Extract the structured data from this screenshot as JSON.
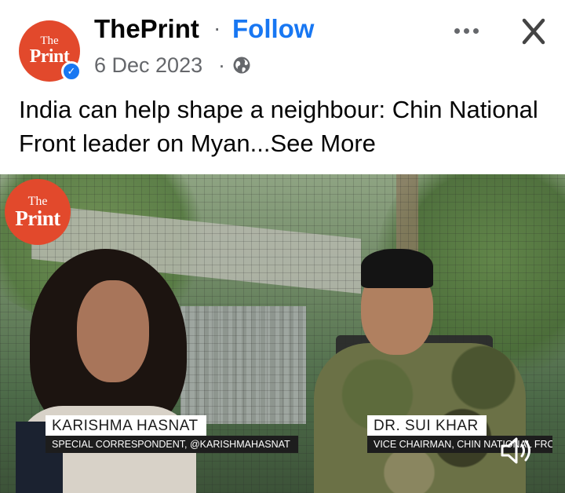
{
  "post": {
    "page_name": "ThePrint",
    "separator": "·",
    "follow_label": "Follow",
    "date": "6 Dec 2023",
    "date_separator": "·",
    "privacy_icon": "globe-icon",
    "more_icon": "more-options-icon",
    "close_icon": "close-icon",
    "avatar": {
      "line1": "The",
      "line2": "Print",
      "verified_icon": "verified-badge-icon"
    },
    "caption": "India can help shape a neighbour: Chin National Front leader on Myan...",
    "see_more_label": "See More"
  },
  "video": {
    "logo": {
      "line1": "The",
      "line2": "Print"
    },
    "host": {
      "name": "KARISHMA HASNAT",
      "role": "SPECIAL CORRESPONDENT, @KARISHMAHASNAT"
    },
    "guest": {
      "name": "DR. SUI KHAR",
      "role": "VICE CHAIRMAN, CHIN NATIONAL FRONT"
    },
    "volume_icon": "volume-muted-icon"
  },
  "colors": {
    "brand_red": "#e2492c",
    "link_blue": "#1877f2",
    "secondary_text": "#65676b"
  }
}
